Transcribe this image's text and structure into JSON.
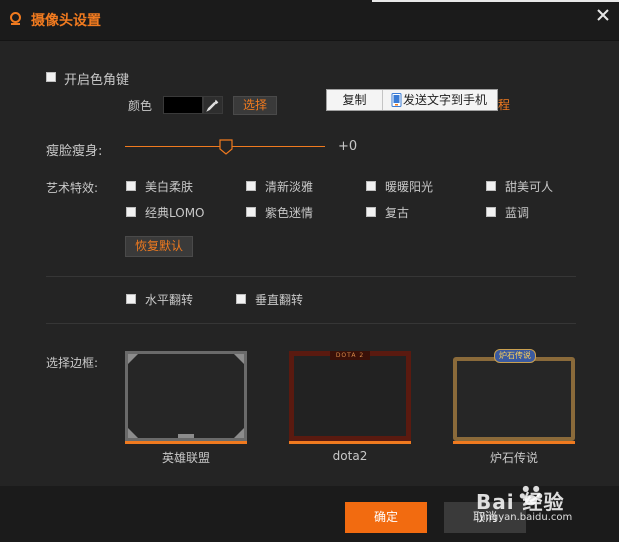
{
  "window": {
    "title": "摄像头设置"
  },
  "chroma": {
    "enable_label": "开启色角键",
    "color_label": "颜色",
    "select_button": "选择",
    "tutorial_link_partial": "程"
  },
  "context_menu": {
    "copy": "复制",
    "send_to_phone": "发送文字到手机"
  },
  "slim": {
    "label": "瘦脸瘦身:",
    "value": "+0",
    "level": 0.5
  },
  "effects": {
    "label": "艺术特效:",
    "items": [
      "美白柔肤",
      "清新淡雅",
      "暖暖阳光",
      "甜美可人",
      "经典LOMO",
      "紫色迷情",
      "复古",
      "蓝调"
    ],
    "reset_button": "恢复默认"
  },
  "flip": {
    "horizontal": "水平翻转",
    "vertical": "垂直翻转"
  },
  "frames": {
    "label": "选择边框:",
    "items": [
      {
        "caption": "英雄联盟"
      },
      {
        "caption": "dota2",
        "banner": "DOTA 2"
      },
      {
        "caption": "炉石传说",
        "banner": "炉石传说"
      }
    ]
  },
  "footer": {
    "ok": "确定",
    "cancel": "取消"
  },
  "watermark": {
    "logo": "Bai 经验",
    "url": "jingyan.baidu.com"
  },
  "colors": {
    "accent": "#f07a1f",
    "bg": "#242424",
    "bar": "#1b1b1b"
  }
}
